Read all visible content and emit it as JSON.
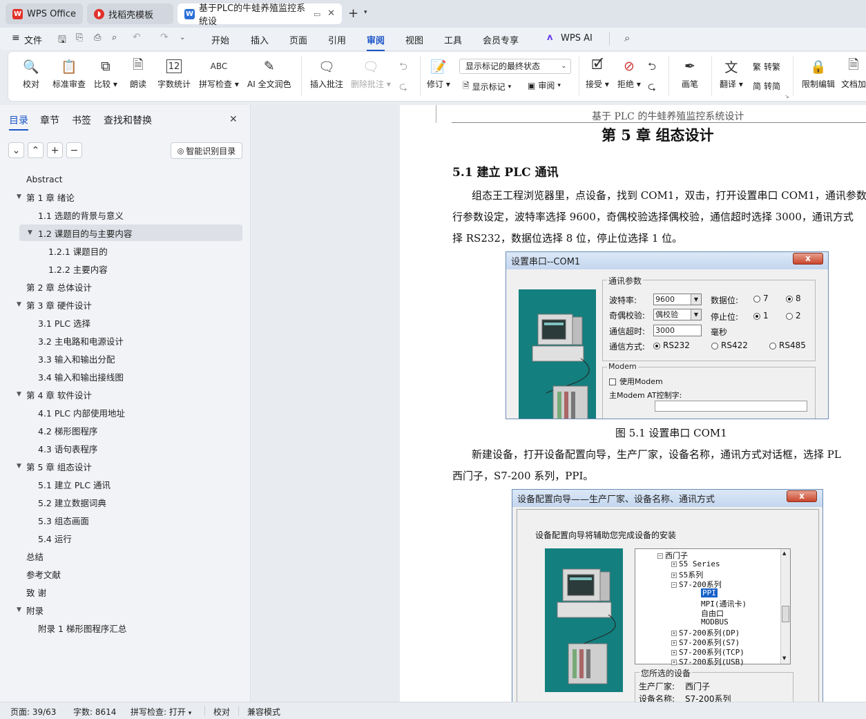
{
  "tabs": {
    "wps_office": "WPS Office",
    "templates": "找稻壳模板",
    "document": "基于PLC的牛蛙养殖监控系统设"
  },
  "menu": {
    "file": "文件",
    "items": [
      "开始",
      "插入",
      "页面",
      "引用",
      "审阅",
      "视图",
      "工具",
      "会员专享"
    ],
    "wps_ai": "WPS AI"
  },
  "ribbon": {
    "proofread": "校对",
    "standard_review": "标准审查",
    "compare": "比较",
    "read_aloud": "朗读",
    "word_count": "字数统计",
    "spell_check": "拼写检查",
    "ai_polish": "AI 全文润色",
    "insert_comment": "插入批注",
    "delete_comment": "删除批注",
    "track_changes": "修订",
    "show_markup_select": "显示标记的最终状态",
    "show_markup": "显示标记",
    "review": "审阅",
    "accept": "接受",
    "reject": "拒绝",
    "pen": "画笔",
    "translate": "翻译",
    "to_traditional": "转繁",
    "to_simplified": "转简",
    "restrict_edit": "限制编辑",
    "doc_permission": "文档加"
  },
  "nav": {
    "tabs": [
      "目录",
      "章节",
      "书签",
      "查找和替换"
    ],
    "smart_toc": "智能识别目录",
    "toc": [
      {
        "label": "Abstract",
        "level": 0,
        "arrow": ""
      },
      {
        "label": "第 1 章  绪论",
        "level": 0,
        "arrow": "▼"
      },
      {
        "label": "1.1  选题的背景与意义",
        "level": 1,
        "arrow": ""
      },
      {
        "label": "1.2  课题目的与主要内容",
        "level": 1,
        "arrow": "▼"
      },
      {
        "label": "1.2.1  课题目的",
        "level": 2,
        "arrow": ""
      },
      {
        "label": "1.2.2  主要内容",
        "level": 2,
        "arrow": ""
      },
      {
        "label": "第 2 章    总体设计",
        "level": 0,
        "arrow": ""
      },
      {
        "label": "第 3 章    硬件设计",
        "level": 0,
        "arrow": "▼"
      },
      {
        "label": "3.1 PLC 选择",
        "level": 1,
        "arrow": ""
      },
      {
        "label": "3.2  主电路和电源设计",
        "level": 1,
        "arrow": ""
      },
      {
        "label": "3.3  输入和输出分配",
        "level": 1,
        "arrow": ""
      },
      {
        "label": "3.4  输入和输出接线图",
        "level": 1,
        "arrow": ""
      },
      {
        "label": "第 4 章    软件设计",
        "level": 0,
        "arrow": "▼"
      },
      {
        "label": "4.1 PLC 内部使用地址",
        "level": 1,
        "arrow": ""
      },
      {
        "label": "4.2  梯形图程序",
        "level": 1,
        "arrow": ""
      },
      {
        "label": "4.3  语句表程序",
        "level": 1,
        "arrow": ""
      },
      {
        "label": "第 5 章    组态设计",
        "level": 0,
        "arrow": "▼"
      },
      {
        "label": "5.1 建立 PLC 通讯",
        "level": 1,
        "arrow": ""
      },
      {
        "label": "5.2  建立数据词典",
        "level": 1,
        "arrow": ""
      },
      {
        "label": "5.3  组态画面",
        "level": 1,
        "arrow": ""
      },
      {
        "label": "5.4 运行",
        "level": 1,
        "arrow": ""
      },
      {
        "label": "总结",
        "level": 0,
        "arrow": ""
      },
      {
        "label": "参考文献",
        "level": 0,
        "arrow": ""
      },
      {
        "label": "致  谢",
        "level": 0,
        "arrow": ""
      },
      {
        "label": "附录",
        "level": 0,
        "arrow": "▼"
      },
      {
        "label": "附录 1  梯形图程序汇总",
        "level": 1,
        "arrow": ""
      }
    ]
  },
  "doc": {
    "header": "基于 PLC 的牛蛙养殖监控系统设计",
    "chapter_title": "第 5 章    组态设计",
    "section_title": "5.1 建立 PLC 通讯",
    "para1": [
      "组态王工程浏览器里，点设备，找到 COM1，双击，打开设置串口 COM1，通讯参数里",
      "行参数设定，波特率选择 9600，奇偶校验选择偶校验，通信超时选择 3000，通讯方式",
      "择 RS232，数据位选择 8 位，停止位选择 1 位。"
    ],
    "fig1_caption": "图 5.1 设置串口 COM1",
    "para2": [
      "新建设备，打开设备配置向导，生产厂家，设备名称，通讯方式对话框，选择 PL",
      "西门子，S7-200 系列，PPI。"
    ]
  },
  "dialog1": {
    "title": "设置串口--COM1",
    "close": "x",
    "group_comm": "通讯参数",
    "baud_label": "波特率:",
    "baud_value": "9600",
    "parity_label": "奇偶校验:",
    "parity_value": "偶校验",
    "timeout_label": "通信超时:",
    "timeout_value": "3000",
    "ms": "毫秒",
    "databits_label": "数据位:",
    "databits_7": "7",
    "databits_8": "8",
    "stopbits_label": "停止位:",
    "stopbits_1": "1",
    "stopbits_2": "2",
    "mode_label": "通信方式:",
    "rs232": "RS232",
    "rs422": "RS422",
    "rs485": "RS485",
    "group_modem": "Modem",
    "use_modem": "使用Modem",
    "modem_at": "主Modem AT控制字:"
  },
  "dialog2": {
    "title": "设备配置向导——生产厂家、设备名称、通讯方式",
    "close": "x",
    "intro": "设备配置向导将辅助您完成设备的安装",
    "tree": [
      {
        "label": "西门子",
        "indent": 0,
        "sign": "−"
      },
      {
        "label": "S5 Series",
        "indent": 1,
        "sign": "+"
      },
      {
        "label": "S5系列",
        "indent": 1,
        "sign": "+"
      },
      {
        "label": "S7-200系列",
        "indent": 1,
        "sign": "−"
      },
      {
        "label": "PPI",
        "indent": 2,
        "sign": ""
      },
      {
        "label": "MPI(通讯卡)",
        "indent": 2,
        "sign": ""
      },
      {
        "label": "自由口",
        "indent": 2,
        "sign": ""
      },
      {
        "label": "MODBUS",
        "indent": 2,
        "sign": ""
      },
      {
        "label": "S7-200系列(DP)",
        "indent": 1,
        "sign": "+"
      },
      {
        "label": "S7-200系列(S7)",
        "indent": 1,
        "sign": "+"
      },
      {
        "label": "S7-200系列(TCP)",
        "indent": 1,
        "sign": "+"
      },
      {
        "label": "S7-200系列(USB)",
        "indent": 1,
        "sign": "+"
      }
    ],
    "selected_group": "您所选的设备",
    "maker_label": "生产厂家:",
    "maker_value": "西门子",
    "device_label": "设备名称:",
    "device_value": "S7-200系列"
  },
  "status": {
    "page": "页面: 39/63",
    "words": "字数: 8614",
    "spell": "拼写检查: 打开",
    "proof": "校对",
    "compat": "兼容模式"
  },
  "colors": {
    "accent": "#1a55c9",
    "teal": "#137f7e",
    "wps_red": "#e0322b",
    "word_blue": "#2b6fd6"
  }
}
